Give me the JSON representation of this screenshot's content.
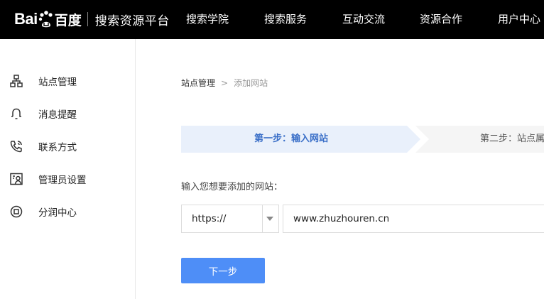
{
  "header": {
    "logo_bai": "Bai",
    "logo_du": "百度",
    "site_title": "搜索资源平台",
    "nav": [
      {
        "label": "搜索学院"
      },
      {
        "label": "搜索服务"
      },
      {
        "label": "互动交流"
      },
      {
        "label": "资源合作"
      },
      {
        "label": "用户中心"
      }
    ]
  },
  "sidebar": {
    "items": [
      {
        "label": "站点管理",
        "icon": "sitemap-icon"
      },
      {
        "label": "消息提醒",
        "icon": "bell-icon"
      },
      {
        "label": "联系方式",
        "icon": "phone-icon"
      },
      {
        "label": "管理员设置",
        "icon": "admin-user-icon"
      },
      {
        "label": "分润中心",
        "icon": "profit-share-icon"
      }
    ]
  },
  "breadcrumb": {
    "root": "站点管理",
    "separator": ">",
    "current": "添加网站"
  },
  "steps": {
    "step1": "第一步：输入网站",
    "step2": "第二步：站点属"
  },
  "form": {
    "label": "输入您想要添加的网站：",
    "protocol_value": "https://",
    "url_value": "www.zhuzhouren.cn"
  },
  "next_label": "下一步",
  "colors": {
    "header_bg": "#000000",
    "accent_blue": "#4e8ef7",
    "step_active_bg": "#e9f0fb",
    "step_active_text": "#3a6fc8"
  }
}
